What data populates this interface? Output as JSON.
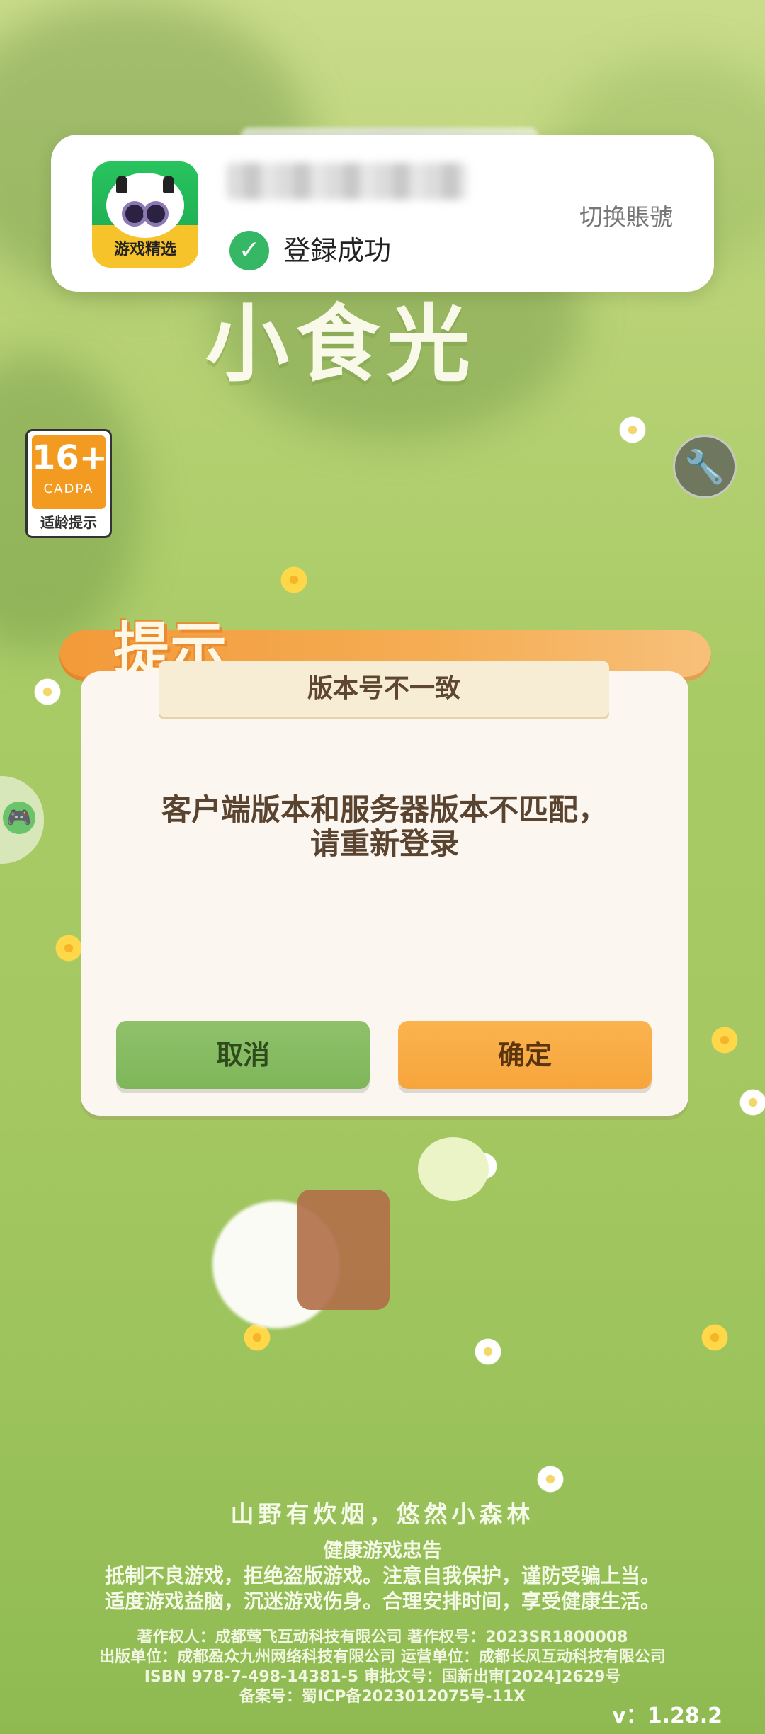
{
  "toast": {
    "app_icon_label": "游戏精选",
    "login_status": "登録成功",
    "switch_account": "切换賬號"
  },
  "game": {
    "title_logo": "小食光",
    "age_rating": "16+",
    "age_org": "CADPA",
    "age_label": "适龄提示"
  },
  "dialog": {
    "banner": "提示",
    "title": "版本号不一致",
    "message_line1": "客户端版本和服务器版本不匹配，",
    "message_line2": "请重新登录",
    "cancel_label": "取消",
    "confirm_label": "确定"
  },
  "footer": {
    "slogan": "山野有炊烟，悠然小森林",
    "health_title": "健康游戏忠告",
    "health_line1": "抵制不良游戏，拒绝盗版游戏。注意自我保护，谨防受骗上当。",
    "health_line2": "适度游戏益脑，沉迷游戏伤身。合理安排时间，享受健康生活。",
    "copyright_line1": "著作权人：成都莺飞互动科技有限公司 著作权号：2023SR1800008",
    "copyright_line2": "出版单位：成都盈众九州网络科技有限公司 运营单位：成都长风互动科技有限公司",
    "copyright_line3": "ISBN 978-7-498-14381-5 审批文号：国新出审[2024]2629号",
    "copyright_line4": "备案号：蜀ICP备2023012075号-11X",
    "version": "v：1.28.2"
  },
  "icons": {
    "check": "check-circle-icon",
    "wrench": "wrench-icon",
    "gamepad": "gamepad-icon"
  },
  "colors": {
    "confirm": "#f7a53c",
    "cancel": "#7fb65a",
    "check": "#36b766"
  }
}
